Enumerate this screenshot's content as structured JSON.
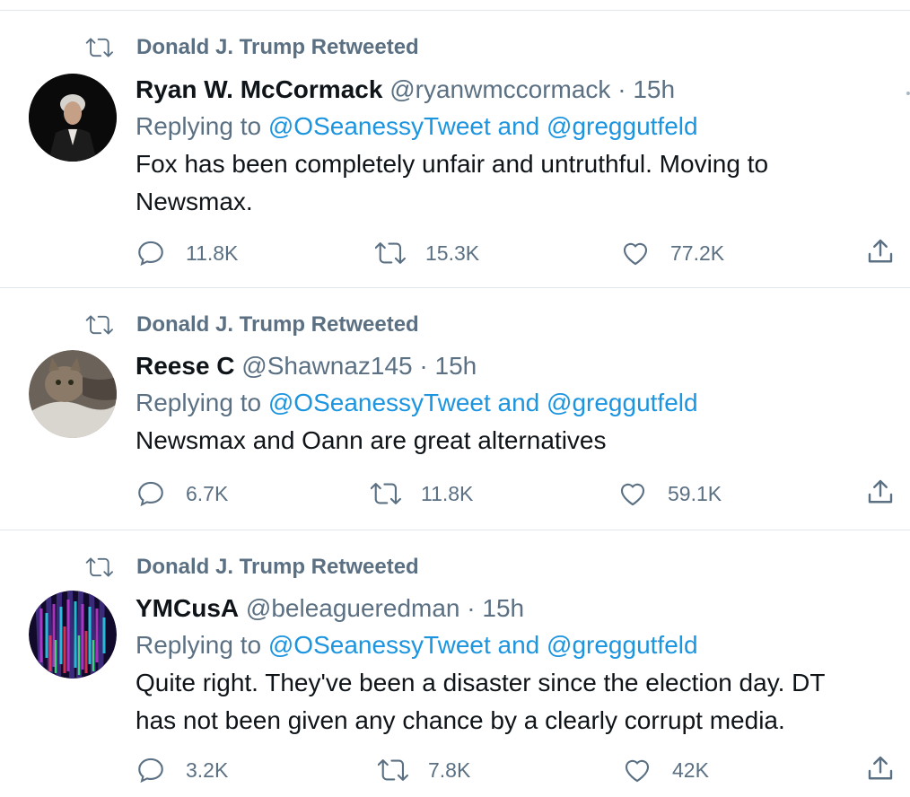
{
  "tweets": [
    {
      "retweeted_by": "Donald J. Trump Retweeted",
      "name": "Ryan W. McCormack",
      "handle": "@ryanwmccormack",
      "separator": "·",
      "time": "15h",
      "replying_prefix": "Replying to",
      "reply_to_1": "@OSeanessyTweet",
      "reply_conj": "and",
      "reply_to_2": "@greggutfeld",
      "text": "Fox has been completely unfair and untruthful. Moving to Newsmax.",
      "replies": "11.8K",
      "retweets": "15.3K",
      "likes": "77.2K"
    },
    {
      "retweeted_by": "Donald J. Trump Retweeted",
      "name": "Reese C",
      "handle": "@Shawnaz145",
      "separator": "·",
      "time": "15h",
      "replying_prefix": "Replying to",
      "reply_to_1": "@OSeanessyTweet",
      "reply_conj": "and",
      "reply_to_2": "@greggutfeld",
      "text": "Newsmax and Oann are great alternatives",
      "replies": "6.7K",
      "retweets": "11.8K",
      "likes": "59.1K"
    },
    {
      "retweeted_by": "Donald J. Trump Retweeted",
      "name": "YMCusA",
      "handle": "@beleagueredman",
      "separator": "·",
      "time": "15h",
      "replying_prefix": "Replying to",
      "reply_to_1": "@OSeanessyTweet",
      "reply_conj": "and",
      "reply_to_2": "@greggutfeld",
      "text": "Quite right. They've been a disaster since the election day. DT has not been given any chance by a clearly corrupt media.",
      "replies": "3.2K",
      "retweets": "7.8K",
      "likes": "42K"
    }
  ],
  "icons": {
    "retweet": "retweet-icon",
    "reply": "reply-icon",
    "like": "heart-icon",
    "share": "share-icon"
  },
  "colors": {
    "muted": "#5b7083",
    "link": "#1b95e0",
    "text": "#0f1419",
    "divider": "#e1e8ed"
  }
}
